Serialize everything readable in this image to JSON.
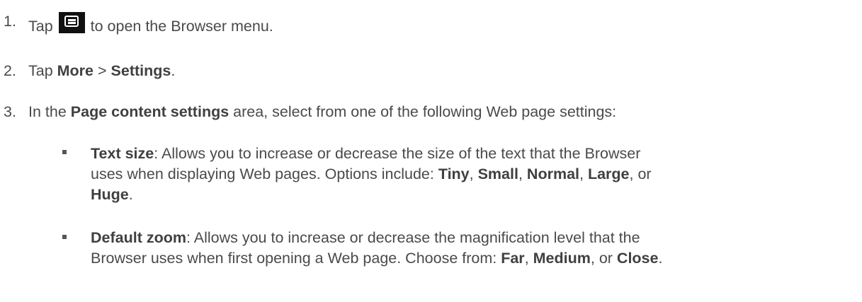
{
  "steps": [
    {
      "number": "1.",
      "before": "Tap",
      "icon": "menu-icon",
      "after": " to open the Browser menu."
    },
    {
      "number": "2.",
      "t1": "Tap ",
      "b1": "More",
      "t2": " > ",
      "b2": "Settings",
      "t3": "."
    },
    {
      "number": "3.",
      "t1": "In the ",
      "b1": "Page content settings",
      "t2": " area, select from one of the following Web page settings:"
    }
  ],
  "bullets": [
    {
      "title": "Text size",
      "line1": ": Allows you to increase or decrease the size of the text that the Browser",
      "line2_a": "uses when displaying Web pages. Options include: ",
      "opt1": "Tiny",
      "sep1": ", ",
      "opt2": "Small",
      "sep2": ", ",
      "opt3": "Normal",
      "sep3": ", ",
      "opt4": "Large",
      "sep4": ", or",
      "opt5": "Huge",
      "end": "."
    },
    {
      "title": "Default zoom",
      "line1": ": Allows you to increase or decrease the magnification level that the",
      "line2_a": "Browser uses when first opening a Web page. Choose from: ",
      "opt1": "Far",
      "sep1": ", ",
      "opt2": "Medium",
      "sep2": ", or ",
      "opt3": "Close",
      "end": "."
    }
  ]
}
